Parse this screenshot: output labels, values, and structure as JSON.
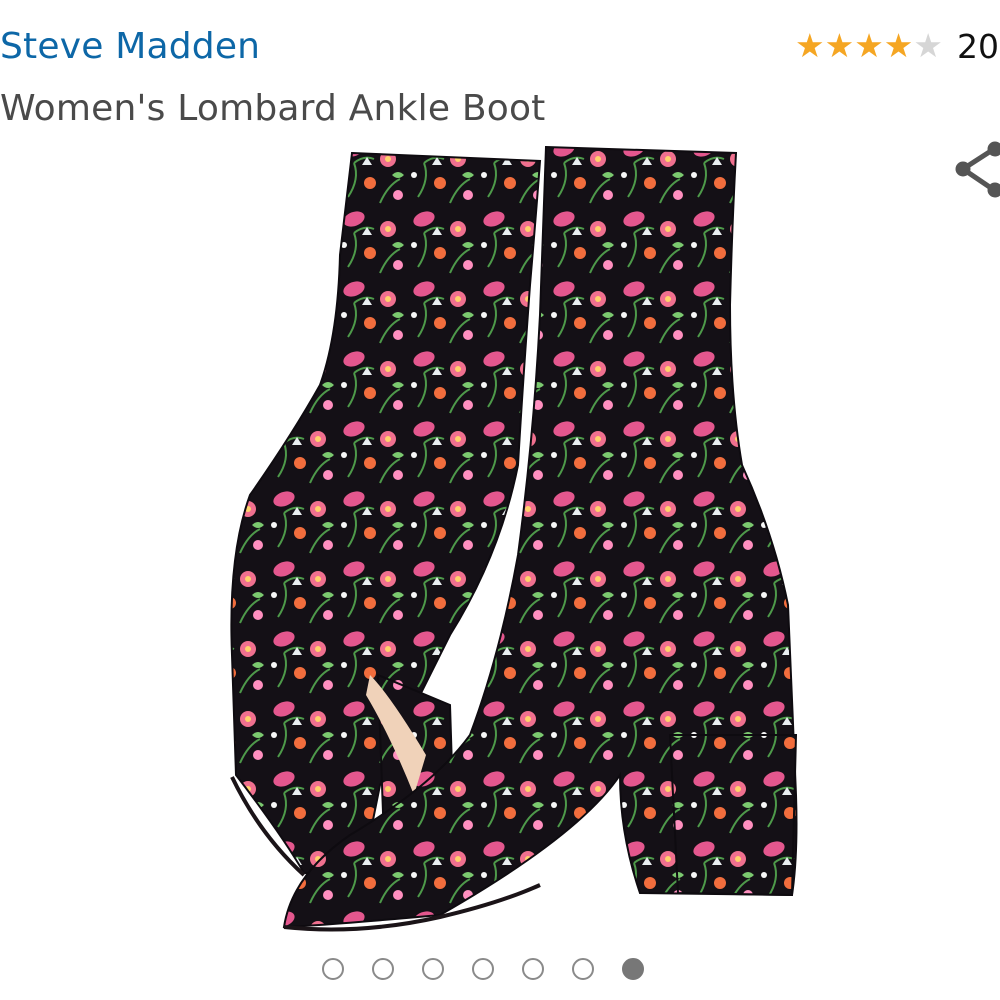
{
  "product": {
    "brand": "Steve Madden",
    "title": "Women's Lombard Ankle Boot",
    "rating": {
      "stars": 4,
      "max": 5,
      "count_text": "20"
    },
    "image_alt": "floral-ankle-boots-image"
  },
  "colors": {
    "brand_link": "#0d67a7",
    "star_filled": "#f5a623",
    "star_empty": "#d6d6d6"
  },
  "carousel": {
    "total": 7,
    "active_index": 6
  },
  "icons": {
    "share": "share-icon"
  }
}
